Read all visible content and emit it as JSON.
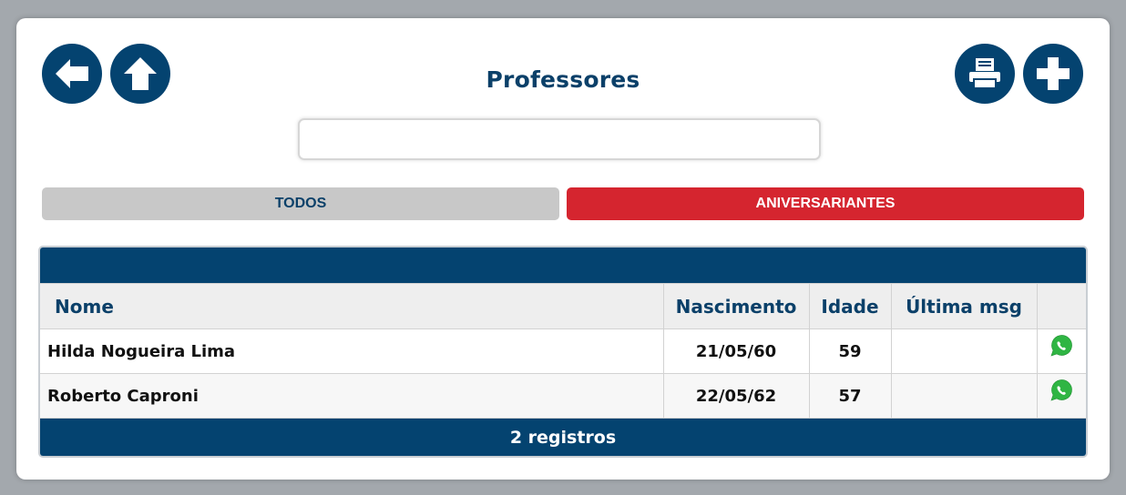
{
  "header": {
    "title": "Professores",
    "back_icon": "arrow-left-icon",
    "home_icon": "arrow-up-icon",
    "print_icon": "printer-icon",
    "add_icon": "plus-icon"
  },
  "search": {
    "value": "",
    "placeholder": ""
  },
  "tabs": [
    {
      "label": "TODOS",
      "color": "#c8c8c8",
      "text_color": "#0b4069"
    },
    {
      "label": "ANIVERSARIANTES",
      "color": "#d5252f",
      "text_color": "#ffffff",
      "active": true
    }
  ],
  "table": {
    "columns": [
      "Nome",
      "Nascimento",
      "Idade",
      "Última msg",
      ""
    ],
    "rows": [
      {
        "nome": "Hilda Nogueira Lima",
        "nascimento": "21/05/60",
        "idade": "59",
        "ultima_msg": "",
        "action_icon": "whatsapp-icon"
      },
      {
        "nome": "Roberto Caproni",
        "nascimento": "22/05/62",
        "idade": "57",
        "ultima_msg": "",
        "action_icon": "whatsapp-icon"
      }
    ],
    "footer": "2 registros"
  },
  "colors": {
    "primary": "#044370",
    "accent": "#d5252f",
    "whatsapp": "#2fb543"
  }
}
